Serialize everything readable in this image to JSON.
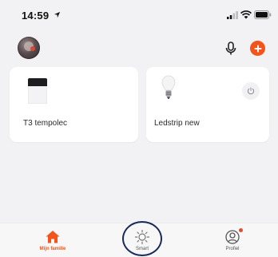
{
  "status_bar": {
    "time": "14:59"
  },
  "colors": {
    "accent": "#f2541b",
    "highlight_circle": "#172a5b"
  },
  "devices": [
    {
      "name": "T3 tempolec",
      "icon": "control-panel-icon"
    },
    {
      "name": "Ledstrip new",
      "icon": "bulb-icon",
      "has_power_button": true
    }
  ],
  "tabs": [
    {
      "label": "Mijn familie",
      "icon": "home-icon",
      "active": true
    },
    {
      "label": "Smart",
      "icon": "sun-icon",
      "active": false
    },
    {
      "label": "Profiel",
      "icon": "profile-icon",
      "active": false
    }
  ]
}
